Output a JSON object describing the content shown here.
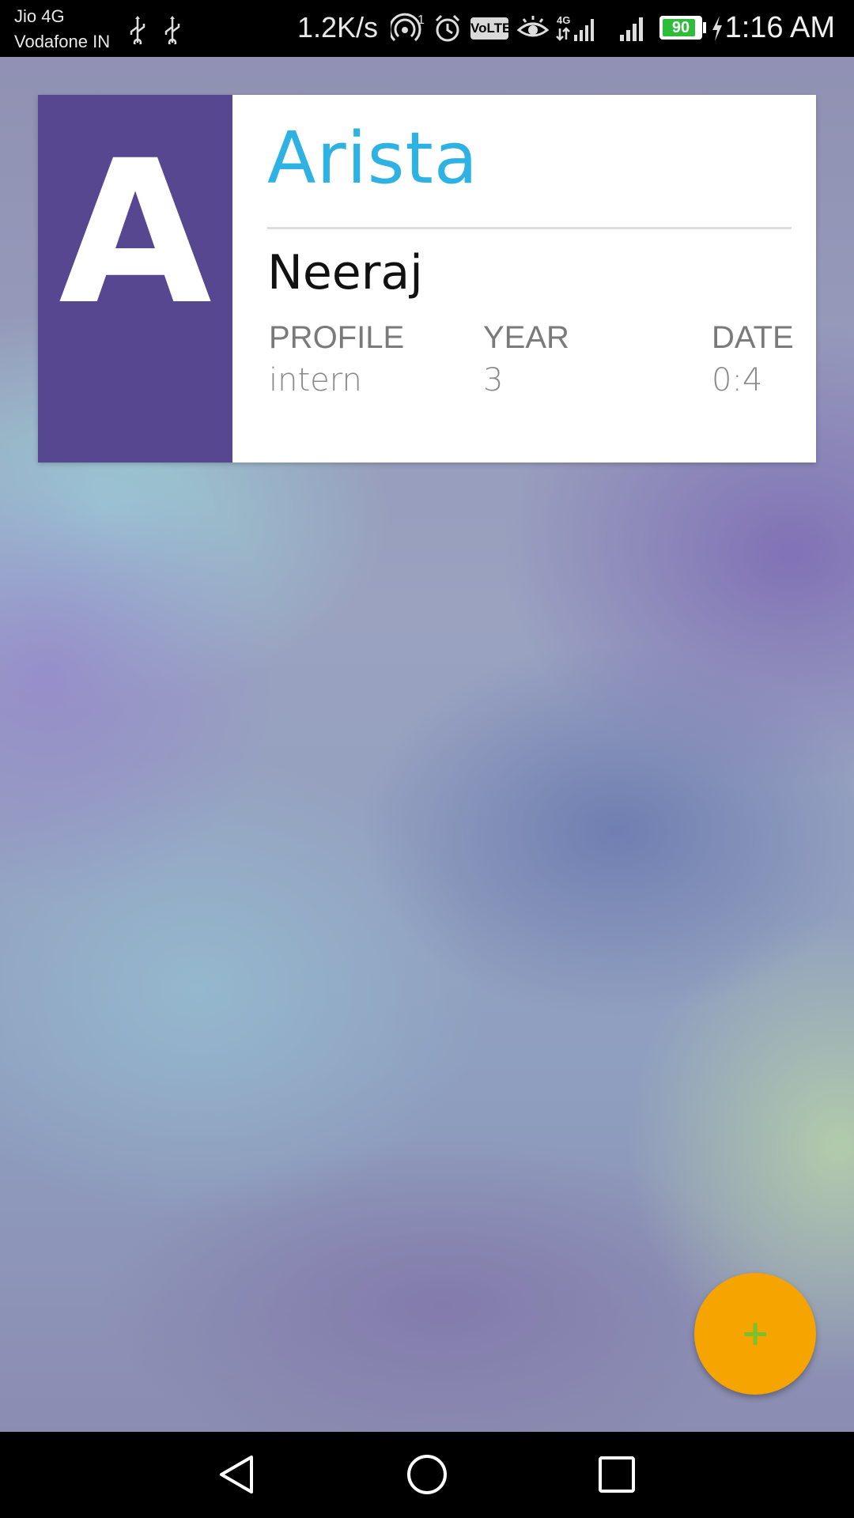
{
  "status_bar": {
    "carrier_1": "Jio 4G",
    "carrier_2": "Vodafone IN",
    "net_speed": "1.2K/s",
    "hotspot_badge": "1",
    "volte": "VoLTE",
    "network_type": "4G",
    "battery_level": "90",
    "battery_fraction": 0.9,
    "time": "1:16 AM",
    "icons": [
      "usb-icon",
      "usb-icon",
      "hotspot-icon",
      "alarm-icon",
      "volte-icon",
      "eye-comfort-icon",
      "signal-4g-icon",
      "signal-icon",
      "battery-icon",
      "charging-icon"
    ]
  },
  "card": {
    "avatar_letter": "A",
    "avatar_color": "#574790",
    "company": "Arista",
    "company_color": "#2eb2e4",
    "name": "Neeraj",
    "fields": [
      {
        "label": "PROFILE",
        "value": "intern"
      },
      {
        "label": "YEAR",
        "value": "3"
      },
      {
        "label": "DATE",
        "value": "0:4"
      }
    ]
  },
  "fab": {
    "icon": "plus-icon",
    "symbol": "+",
    "color": "#f5a400"
  },
  "nav_bar": {
    "buttons": [
      "back-icon",
      "home-icon",
      "recents-icon"
    ]
  }
}
